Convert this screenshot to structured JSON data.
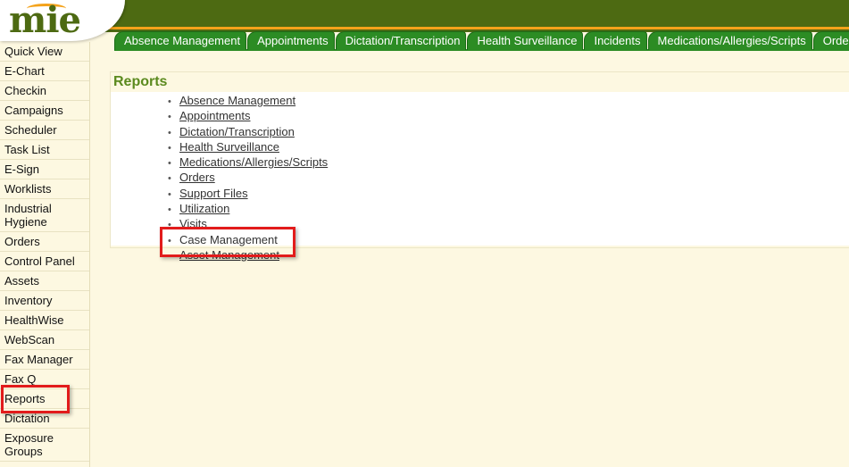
{
  "logo": {
    "text": "mie"
  },
  "tabs": [
    "Absence Management",
    "Appointments",
    "Dictation/Transcription",
    "Health Surveillance",
    "Incidents",
    "Medications/Allergies/Scripts",
    "Orders"
  ],
  "sidebar": {
    "items": [
      "Quick View",
      "E-Chart",
      "Checkin",
      "Campaigns",
      "Scheduler",
      "Task List",
      "E-Sign",
      "Worklists",
      "Industrial Hygiene",
      "Orders",
      "Control Panel",
      "Assets",
      "Inventory",
      "HealthWise",
      "WebScan",
      "Fax Manager",
      "Fax Q",
      "Reports",
      "Dictation",
      "Exposure Groups"
    ]
  },
  "reports": {
    "title": "Reports",
    "items": [
      {
        "label": "Absence Management",
        "link": true
      },
      {
        "label": "Appointments",
        "link": true
      },
      {
        "label": "Dictation/Transcription",
        "link": true
      },
      {
        "label": "Health Surveillance",
        "link": true
      },
      {
        "label": "Medications/Allergies/Scripts",
        "link": true
      },
      {
        "label": "Orders",
        "link": true
      },
      {
        "label": "Support Files",
        "link": true
      },
      {
        "label": "Utilization",
        "link": true
      },
      {
        "label": "Visits",
        "link": true
      },
      {
        "label": "Case Management",
        "link": false
      },
      {
        "label": "Asset Management",
        "link": true
      }
    ]
  },
  "colors": {
    "banner": "#4d6a12",
    "accent": "#f4a21a",
    "tab": "#2c8c24",
    "highlight": "#e21b1b",
    "title": "#5b8a1e"
  }
}
